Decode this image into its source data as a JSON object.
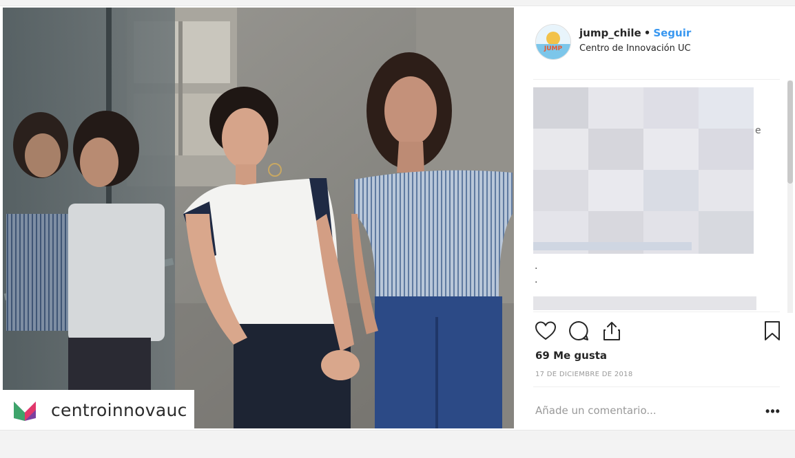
{
  "post": {
    "username": "jump_chile",
    "separator": "•",
    "follow_label": "Seguir",
    "location": "Centro de Innovación UC",
    "avatar_text": "JUMP",
    "likes": "69 Me gusta",
    "date": "17 DE DICIEMBRE DE 2018",
    "comment_placeholder": "Añade un comentario...",
    "more_label": "•••"
  },
  "caption": {
    "pixelated": true,
    "visible_fragments": [
      "e",
      ".",
      "."
    ]
  },
  "watermark": {
    "text": "centroinnovauc"
  },
  "icons": [
    "heart-icon",
    "comment-icon",
    "share-icon",
    "bookmark-icon"
  ],
  "colors": {
    "accent": "#3897f0",
    "text": "#262626",
    "muted": "#999999"
  }
}
